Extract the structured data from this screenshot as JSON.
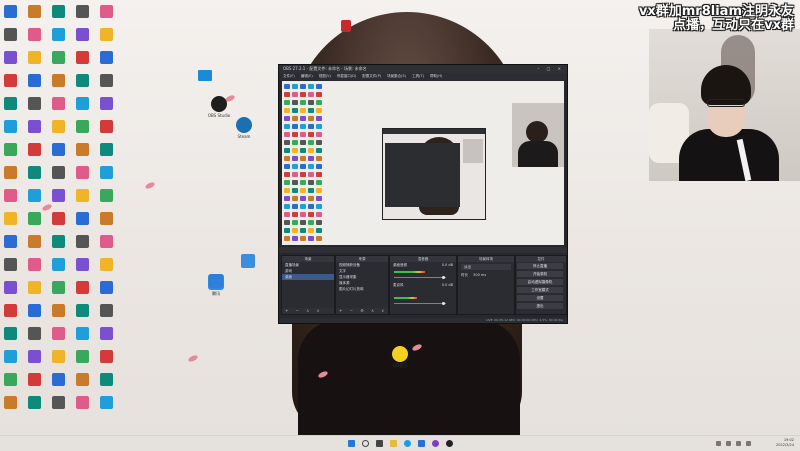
{
  "overlay": {
    "line1": "vx群加mr8liam注明永友",
    "line2": "点播，互动只在vx群"
  },
  "desktop": {
    "icons": [
      {
        "label": "OBS Studio",
        "icon": "obs-icon"
      },
      {
        "label": "Steam",
        "icon": "steam-icon"
      },
      {
        "label": "腾讯",
        "icon": "qq-icon"
      },
      {
        "label": "QQ音乐",
        "icon": "music-icon"
      },
      {
        "label": "Experience",
        "icon": "app-icon"
      }
    ]
  },
  "obs": {
    "title": "OBS 27.2.1 - 配置文件: 未命名 - 场景: 未命名",
    "menu": [
      "文件(F)",
      "编辑(E)",
      "视图(V)",
      "停靠窗口(D)",
      "配置文件(P)",
      "场景集合(S)",
      "工具(T)",
      "帮助(H)"
    ],
    "panels": {
      "scenes": {
        "title": "场景",
        "items": [
          "直播场景",
          "游戏",
          "桌面"
        ]
      },
      "sources": {
        "title": "来源",
        "items": [
          "视频捕获设备",
          "文字",
          "显示器采集",
          "媒体源",
          "图片幻灯片放映"
        ]
      },
      "mixer": {
        "title": "混音器",
        "tracks": [
          {
            "name": "桌面音频",
            "db": "0.0 dB",
            "level": 0.6
          },
          {
            "name": "麦克风",
            "db": "0.0 dB",
            "level": 0.45
          }
        ]
      },
      "transitions": {
        "title": "场景转场",
        "type": "淡出",
        "duration_label": "时长",
        "duration": "300 ms"
      },
      "controls": {
        "title": "控件",
        "buttons": [
          "停止直播",
          "开始录制",
          "启动虚拟摄像机",
          "工作室模式",
          "设置",
          "退出"
        ]
      }
    },
    "status": "LIVE: 00:35:12   REC: 00:00:00   CPU: 4.5%, 60.00 fps"
  },
  "taskbar": {
    "time": "19:02",
    "date": "2022/3/24"
  },
  "colors": {
    "obs_bg": "#26282c",
    "accent_live": "#3a5a8a"
  }
}
